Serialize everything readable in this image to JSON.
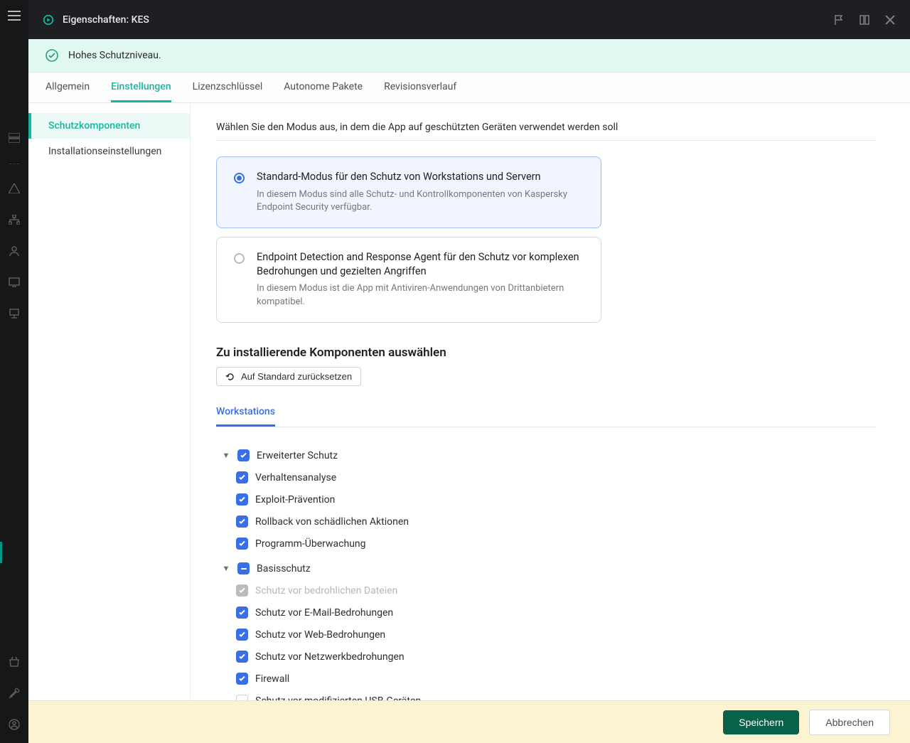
{
  "header": {
    "title": "Eigenschaften: KES"
  },
  "banner": {
    "text": "Hohes Schutzniveau."
  },
  "tabs": [
    {
      "label": "Allgemein",
      "active": false
    },
    {
      "label": "Einstellungen",
      "active": true
    },
    {
      "label": "Lizenzschlüssel",
      "active": false
    },
    {
      "label": "Autonome Pakete",
      "active": false
    },
    {
      "label": "Revisionsverlauf",
      "active": false
    }
  ],
  "sidenav": [
    {
      "label": "Schutzkomponenten",
      "active": true
    },
    {
      "label": "Installationseinstellungen",
      "active": false
    }
  ],
  "content": {
    "mode_heading": "Wählen Sie den Modus aus, in dem die App auf geschützten Geräten verwendet werden soll",
    "modes": [
      {
        "label": "Standard-Modus für den Schutz von Workstations und Servern",
        "desc": "In diesem Modus sind alle Schutz- und Kontrollkomponenten von Kaspersky Endpoint Security verfügbar.",
        "selected": true
      },
      {
        "label": "Endpoint Detection and Response Agent für den Schutz vor komplexen Bedrohungen und gezielten Angriffen",
        "desc": "In diesem Modus ist die App mit Antiviren-Anwendungen von Drittanbietern kompatibel.",
        "selected": false
      }
    ],
    "components_title": "Zu installierende Komponenten auswählen",
    "reset_label": "Auf Standard zurücksetzen",
    "subtab": "Workstations",
    "tree": [
      {
        "label": "Erweiterter Schutz",
        "state": "checked",
        "children": [
          {
            "label": "Verhaltensanalyse",
            "state": "checked"
          },
          {
            "label": "Exploit-Prävention",
            "state": "checked"
          },
          {
            "label": "Rollback von schädlichen Aktionen",
            "state": "checked"
          },
          {
            "label": "Programm-Überwachung",
            "state": "checked"
          }
        ]
      },
      {
        "label": "Basisschutz",
        "state": "indeterminate",
        "children": [
          {
            "label": "Schutz vor bedrohlichen Dateien",
            "state": "disabled"
          },
          {
            "label": "Schutz vor E-Mail-Bedrohungen",
            "state": "checked"
          },
          {
            "label": "Schutz vor Web-Bedrohungen",
            "state": "checked"
          },
          {
            "label": "Schutz vor Netzwerkbedrohungen",
            "state": "checked"
          },
          {
            "label": "Firewall",
            "state": "checked"
          },
          {
            "label": "Schutz vor modifizierten USB-Geräten",
            "state": "unchecked"
          }
        ]
      }
    ]
  },
  "footer": {
    "save": "Speichern",
    "cancel": "Abbrechen"
  }
}
